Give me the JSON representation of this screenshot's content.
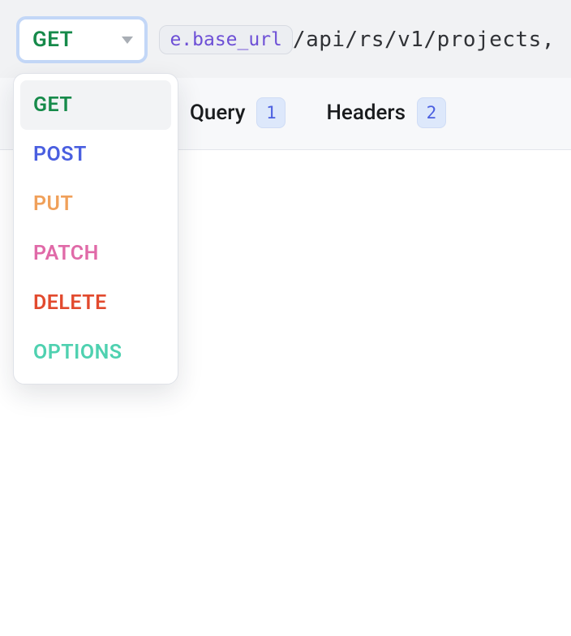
{
  "method": {
    "selected": "GET",
    "options": [
      {
        "label": "GET",
        "colorClass": "c-get",
        "selected": true
      },
      {
        "label": "POST",
        "colorClass": "c-post",
        "selected": false
      },
      {
        "label": "PUT",
        "colorClass": "c-put",
        "selected": false
      },
      {
        "label": "PATCH",
        "colorClass": "c-patch",
        "selected": false
      },
      {
        "label": "DELETE",
        "colorClass": "c-delete",
        "selected": false
      },
      {
        "label": "OPTIONS",
        "colorClass": "c-options",
        "selected": false
      }
    ]
  },
  "url": {
    "variable_chip": "e.base_url",
    "path": "/api/rs/v1/projects,"
  },
  "tabs": {
    "query": {
      "label": "Query",
      "count": "1"
    },
    "headers": {
      "label": "Headers",
      "count": "2"
    }
  }
}
